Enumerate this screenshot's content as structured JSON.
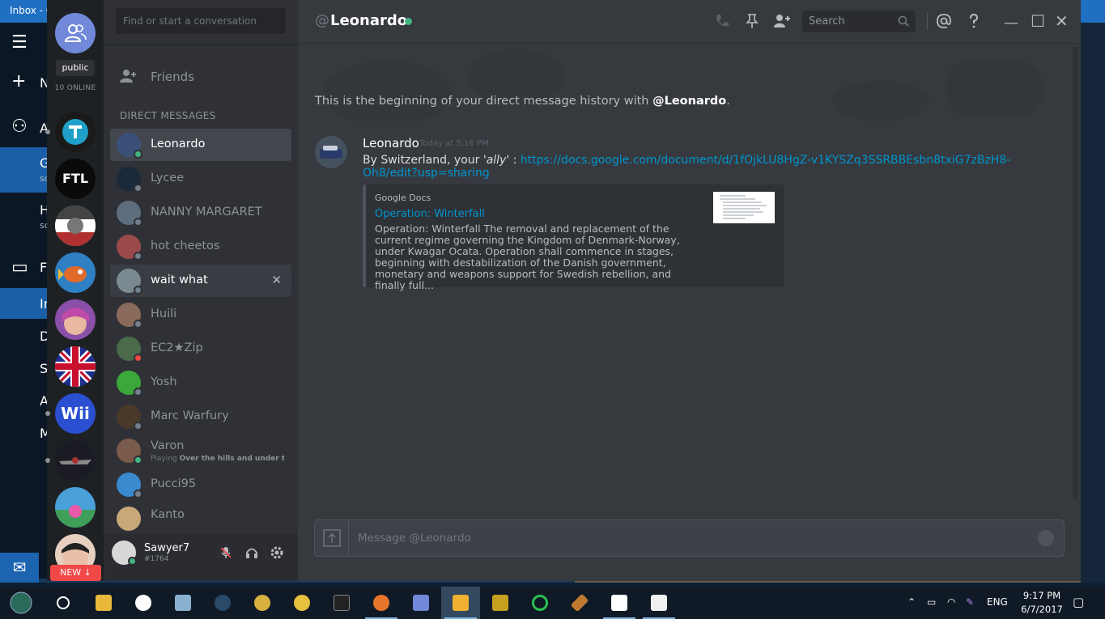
{
  "background_app": {
    "title": "Inbox - G",
    "items": [
      "N",
      "A",
      "F",
      "D",
      "S",
      "A",
      "M"
    ],
    "selected_items": [
      {
        "label": "G",
        "sub": "sc"
      },
      {
        "label": "H",
        "sub": "sc"
      },
      {
        "label": "In"
      }
    ]
  },
  "guilds": {
    "dm_badge": "public",
    "online": "10 ONLINE",
    "servers": [
      {
        "label": "T",
        "color": "#1a1a1a",
        "fg": "#22a0c8"
      },
      {
        "label": "FTL",
        "color": "#0a0a0a",
        "fg": "#ffffff"
      },
      {
        "label": "",
        "color": "#c8c0b0",
        "fg": "#222"
      },
      {
        "label": "",
        "color": "#2f7fc4",
        "fg": "#e06a2a"
      },
      {
        "label": "",
        "color": "#8a4fa8",
        "fg": "#fff"
      },
      {
        "label": "",
        "color": "#c8102e",
        "fg": "#fff"
      },
      {
        "label": "Wii",
        "color": "#2a4fd0",
        "fg": "#ffffff"
      },
      {
        "label": "",
        "color": "#1b1b24",
        "fg": "#a33"
      },
      {
        "label": "",
        "color": "#3f9e58",
        "fg": "#fff"
      },
      {
        "label": "",
        "color": "#e8d0c0",
        "fg": "#333"
      }
    ],
    "new_label": "NEW ↓"
  },
  "sidebar": {
    "search_placeholder": "Find or start a conversation",
    "friends_label": "Friends",
    "dm_header": "DIRECT MESSAGES",
    "dms": [
      {
        "name": "Leonardo",
        "status": "online",
        "color": "#3b5078"
      },
      {
        "name": "Lycee",
        "status": "offline",
        "color": "#1a2a3a"
      },
      {
        "name": "NANNY MARGARET",
        "status": "offline",
        "color": "#5e6e7e"
      },
      {
        "name": "hot cheetos",
        "status": "offline",
        "color": "#9a4a4a"
      },
      {
        "name": "wait what",
        "status": "offline",
        "color": "#7a8a90"
      },
      {
        "name": "Huili",
        "status": "offline",
        "color": "#8a6a5a"
      },
      {
        "name": "EC2★Zip",
        "status": "dnd",
        "color": "#4a6a4a"
      },
      {
        "name": "Yosh",
        "status": "offline",
        "color": "#3aa83a"
      },
      {
        "name": "Marc Warfury",
        "status": "offline",
        "color": "#4a3a2a"
      },
      {
        "name": "Varon",
        "status": "online",
        "color": "#7a5a4a",
        "game_prefix": "Playing ",
        "game": "Over the hills and under the ..."
      },
      {
        "name": "Pucci95",
        "status": "offline",
        "color": "#3a8ad0"
      },
      {
        "name": "Kanto",
        "status": "offline",
        "color": "#c8a878"
      }
    ]
  },
  "user": {
    "name": "Sawyer7",
    "tag": "#1764"
  },
  "chat": {
    "at": "@",
    "channel": "Leonardo",
    "search_placeholder": "Search",
    "begin_prefix": "This is the beginning of your direct message history with ",
    "begin_name": "@Leonardo",
    "begin_suffix": ".",
    "message": {
      "author": "Leonardo",
      "timestamp": "Today at 5:16 PM",
      "text_prefix": "By Switzerland, your '",
      "text_italic": "ally",
      "text_suffix": "' : ",
      "link": "https://docs.google.com/document/d/1fOjkLU8HgZ-v1KYSZq3SSRBBEsbn8txiG7zBzH8-Oh8/edit?usp=sharing"
    },
    "embed": {
      "provider": "Google Docs",
      "title": "Operation: Winterfall",
      "description": "Operation: Winterfall The removal and replacement of the current regime governing the Kingdom of Denmark-Norway, under Kwagar Ocata. Operation shall commence in stages, beginning with destabilization of the Danish government, monetary and weapons support for Swedish rebellion, and finally full..."
    },
    "input_placeholder": "Message @Leonardo"
  },
  "taskbar": {
    "apps": [
      "start",
      "cortana",
      "explorer",
      "opera",
      "photos",
      "steam",
      "timer",
      "timer2",
      "cmd",
      "firefox",
      "discord",
      "discord-active",
      "sublime",
      "opera-gx",
      "weapon",
      "mail",
      "java"
    ],
    "language": "ENG",
    "time": "9:17 PM",
    "date": "6/7/2017"
  }
}
